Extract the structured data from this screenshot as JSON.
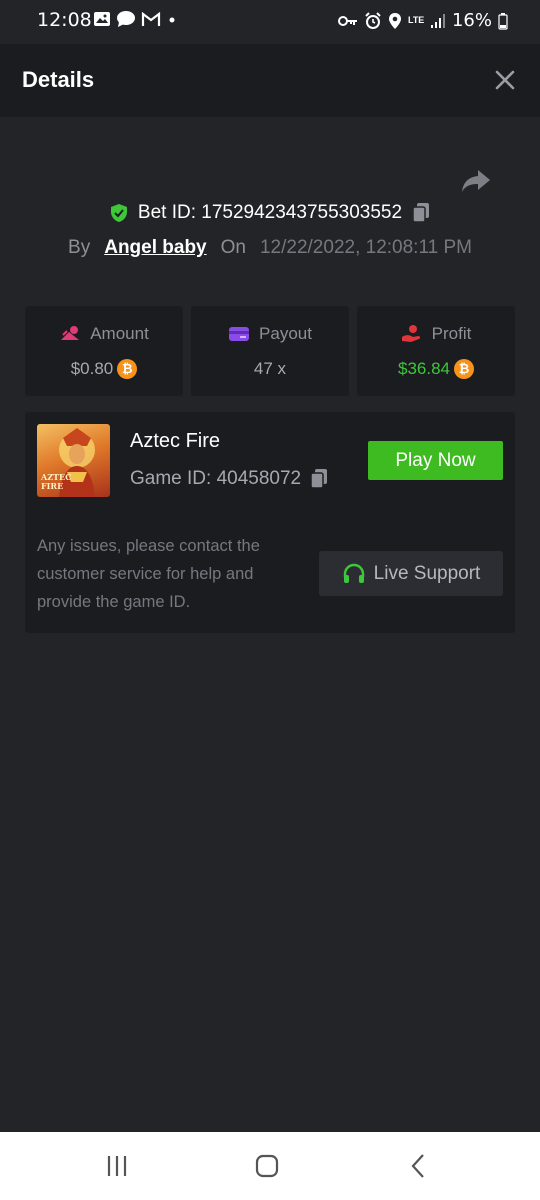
{
  "status_bar": {
    "time": "12:08",
    "network": "LTE",
    "battery": "16%",
    "left_icons": [
      "image-icon",
      "chat-icon",
      "gmail-icon",
      "dot-icon"
    ],
    "right_icons": [
      "key-icon",
      "alarm-icon",
      "location-icon",
      "lte-icon",
      "signal-icon",
      "battery-icon"
    ]
  },
  "header": {
    "title": "Details"
  },
  "bet": {
    "label": "Bet ID: 1752942343755303552",
    "by_label": "By",
    "user": "Angel baby",
    "on_label": "On",
    "datetime": "12/22/2022, 12:08:11 PM"
  },
  "stats": {
    "amount": {
      "label": "Amount",
      "value": "$0.80",
      "icon": "money-icon",
      "icon_color": "#e03a78"
    },
    "payout": {
      "label": "Payout",
      "value": "47 x",
      "icon": "card-icon",
      "icon_color": "#8a4be8"
    },
    "profit": {
      "label": "Profit",
      "value": "$36.84",
      "icon": "hand-coin-icon",
      "icon_color": "#e2343b",
      "value_color": "#3fc73a"
    }
  },
  "game": {
    "name": "Aztec Fire",
    "id_text": "Game ID: 40458072",
    "thumb_text": "AZTEC FIRE",
    "play_label": "Play Now",
    "support_text": "Any issues, please contact the customer service for help and provide the game ID.",
    "live_support_label": "Live Support"
  },
  "colors": {
    "background": "#232428",
    "card": "#1b1c20",
    "accent_green": "#3dbb21",
    "shield_green": "#3fc73a",
    "bitcoin": "#f7931a"
  }
}
